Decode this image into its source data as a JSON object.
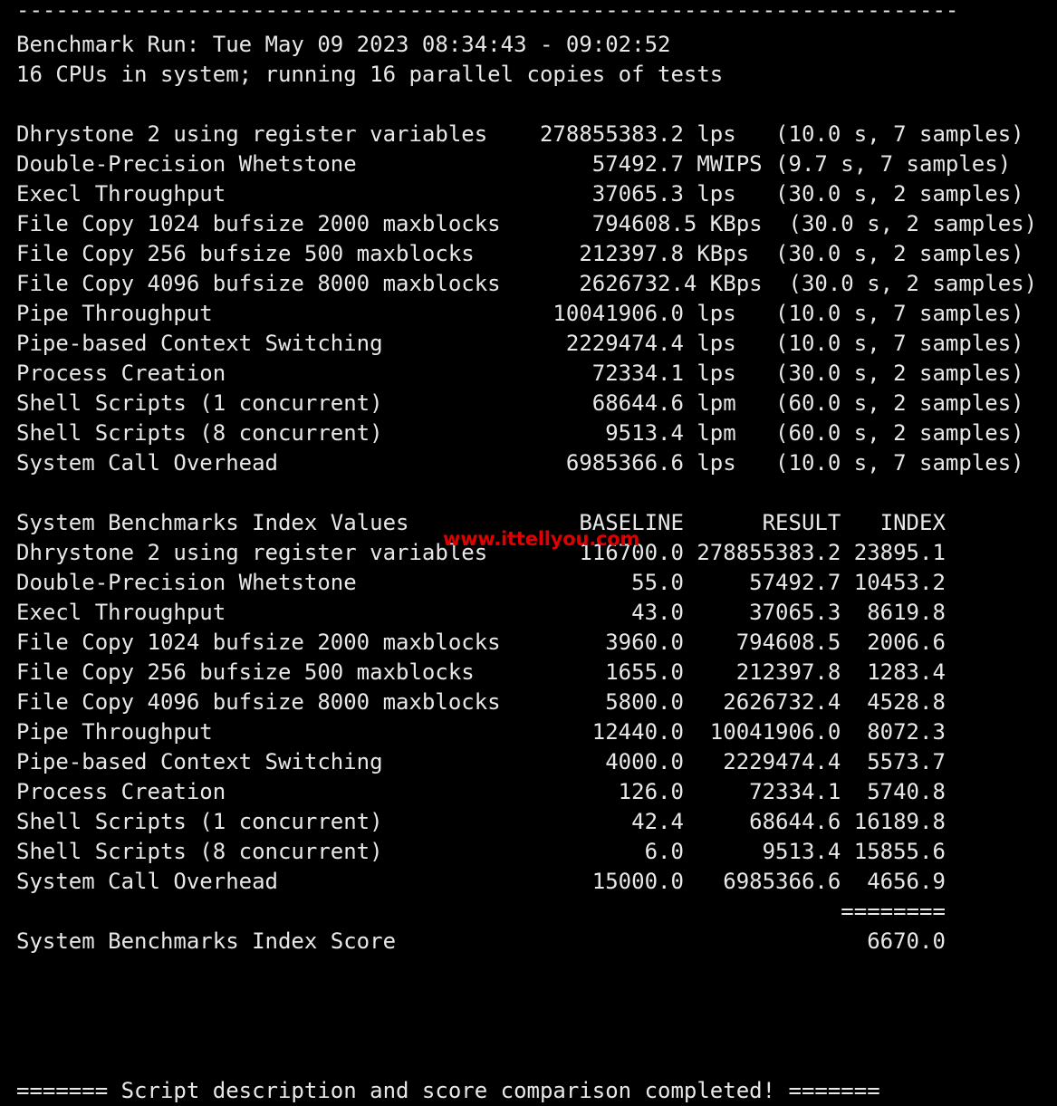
{
  "terminal": {
    "title": "UnixBench benchmark results",
    "background_color": "#000000",
    "text_color": "#e8e8e8",
    "top_rule": "------------------------------------------------------------------------",
    "run_header": "Benchmark Run: Tue May 09 2023 08:34:43 - 09:02:52",
    "cpu_header": "16 CPUs in system; running 16 parallel copies of tests",
    "results_section": {
      "rows": [
        {
          "name": "Dhrystone 2 using register variables",
          "value": "278855383.2",
          "unit": "lps",
          "timing": "(10.0 s, 7 samples)"
        },
        {
          "name": "Double-Precision Whetstone",
          "value": "57492.7",
          "unit": "MWIPS",
          "timing": "(9.7 s, 7 samples)"
        },
        {
          "name": "Execl Throughput",
          "value": "37065.3",
          "unit": "lps",
          "timing": "(30.0 s, 2 samples)"
        },
        {
          "name": "File Copy 1024 bufsize 2000 maxblocks",
          "value": "794608.5",
          "unit": "KBps",
          "timing": "(30.0 s, 2 samples)"
        },
        {
          "name": "File Copy 256 bufsize 500 maxblocks",
          "value": "212397.8",
          "unit": "KBps",
          "timing": "(30.0 s, 2 samples)"
        },
        {
          "name": "File Copy 4096 bufsize 8000 maxblocks",
          "value": "2626732.4",
          "unit": "KBps",
          "timing": "(30.0 s, 2 samples)"
        },
        {
          "name": "Pipe Throughput",
          "value": "10041906.0",
          "unit": "lps",
          "timing": "(10.0 s, 7 samples)"
        },
        {
          "name": "Pipe-based Context Switching",
          "value": "2229474.4",
          "unit": "lps",
          "timing": "(10.0 s, 7 samples)"
        },
        {
          "name": "Process Creation",
          "value": "72334.1",
          "unit": "lps",
          "timing": "(30.0 s, 2 samples)"
        },
        {
          "name": "Shell Scripts (1 concurrent)",
          "value": "68644.6",
          "unit": "lpm",
          "timing": "(60.0 s, 2 samples)"
        },
        {
          "name": "Shell Scripts (8 concurrent)",
          "value": "9513.4",
          "unit": "lpm",
          "timing": "(60.0 s, 2 samples)"
        },
        {
          "name": "System Call Overhead",
          "value": "6985366.6",
          "unit": "lps",
          "timing": "(10.0 s, 7 samples)"
        }
      ]
    },
    "index_section": {
      "title": "System Benchmarks Index Values",
      "columns": [
        "BASELINE",
        "RESULT",
        "INDEX"
      ],
      "rows": [
        {
          "name": "Dhrystone 2 using register variables",
          "baseline": "116700.0",
          "result": "278855383.2",
          "index": "23895.1"
        },
        {
          "name": "Double-Precision Whetstone",
          "baseline": "55.0",
          "result": "57492.7",
          "index": "10453.2"
        },
        {
          "name": "Execl Throughput",
          "baseline": "43.0",
          "result": "37065.3",
          "index": "8619.8"
        },
        {
          "name": "File Copy 1024 bufsize 2000 maxblocks",
          "baseline": "3960.0",
          "result": "794608.5",
          "index": "2006.6"
        },
        {
          "name": "File Copy 256 bufsize 500 maxblocks",
          "baseline": "1655.0",
          "result": "212397.8",
          "index": "1283.4"
        },
        {
          "name": "File Copy 4096 bufsize 8000 maxblocks",
          "baseline": "5800.0",
          "result": "2626732.4",
          "index": "4528.8"
        },
        {
          "name": "Pipe Throughput",
          "baseline": "12440.0",
          "result": "10041906.0",
          "index": "8072.3"
        },
        {
          "name": "Pipe-based Context Switching",
          "baseline": "4000.0",
          "result": "2229474.4",
          "index": "5573.7"
        },
        {
          "name": "Process Creation",
          "baseline": "126.0",
          "result": "72334.1",
          "index": "5740.8"
        },
        {
          "name": "Shell Scripts (1 concurrent)",
          "baseline": "42.4",
          "result": "68644.6",
          "index": "16189.8"
        },
        {
          "name": "Shell Scripts (8 concurrent)",
          "baseline": "6.0",
          "result": "9513.4",
          "index": "15855.6"
        },
        {
          "name": "System Call Overhead",
          "baseline": "15000.0",
          "result": "6985366.6",
          "index": "4656.9"
        }
      ],
      "score_rule": "========",
      "score_label": "System Benchmarks Index Score",
      "score_value": "6670.0"
    },
    "footer": "======= Script description and score comparison completed! =======",
    "watermark": {
      "text": "www.ittellyou.com",
      "color": "#e00000"
    }
  }
}
